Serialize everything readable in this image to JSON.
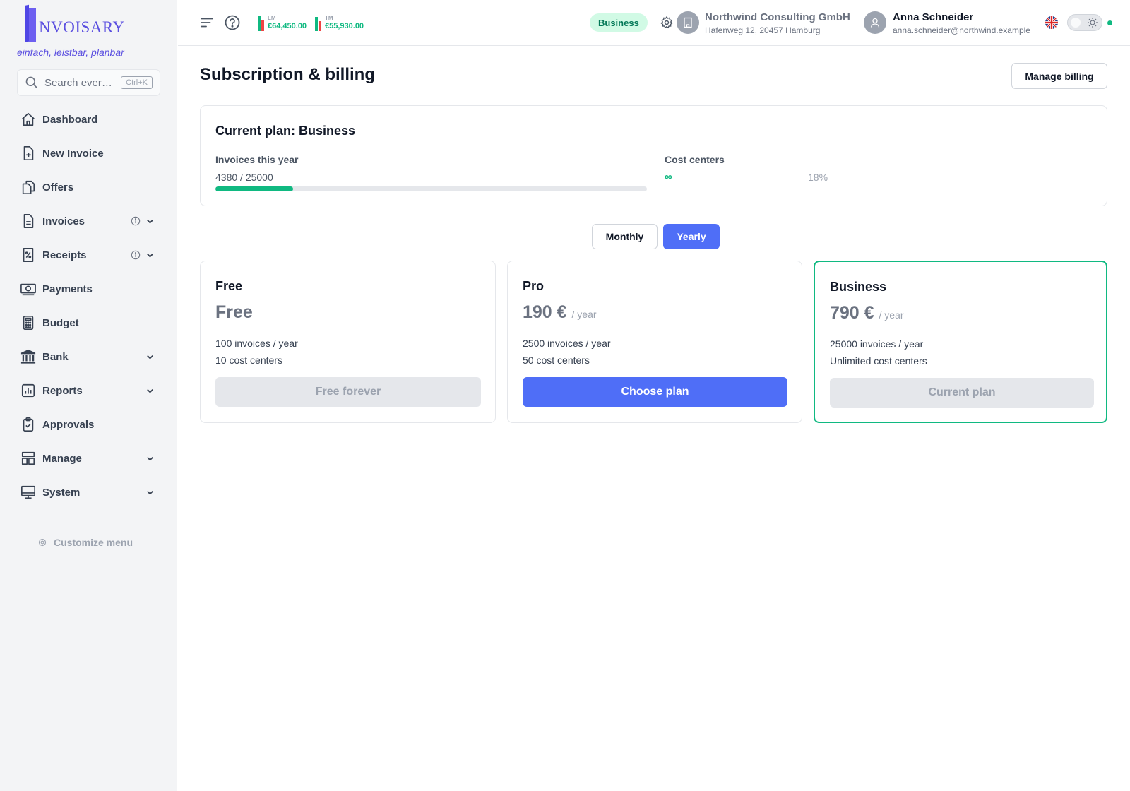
{
  "brand": {
    "logo_text": "NVOISARY",
    "tagline": "einfach, leistbar, planbar",
    "accent": "#5b4fe0"
  },
  "search": {
    "placeholder": "Search ever…",
    "shortcut": "Ctrl+K"
  },
  "sidebar": {
    "items": [
      {
        "label": "Dashboard",
        "icon": "home-icon",
        "info": false,
        "chevron": false
      },
      {
        "label": "New Invoice",
        "icon": "file-plus-icon",
        "info": false,
        "chevron": false
      },
      {
        "label": "Offers",
        "icon": "copy-icon",
        "info": false,
        "chevron": false
      },
      {
        "label": "Invoices",
        "icon": "file-text-icon",
        "info": true,
        "chevron": true
      },
      {
        "label": "Receipts",
        "icon": "receipt-percent-icon",
        "info": true,
        "chevron": true
      },
      {
        "label": "Payments",
        "icon": "banknote-icon",
        "info": false,
        "chevron": false
      },
      {
        "label": "Budget",
        "icon": "calculator-icon",
        "info": false,
        "chevron": false
      },
      {
        "label": "Bank",
        "icon": "bank-icon",
        "info": false,
        "chevron": true
      },
      {
        "label": "Reports",
        "icon": "chart-icon",
        "info": false,
        "chevron": true
      },
      {
        "label": "Approvals",
        "icon": "clipboard-check-icon",
        "info": false,
        "chevron": false
      },
      {
        "label": "Manage",
        "icon": "layout-icon",
        "info": false,
        "chevron": true
      },
      {
        "label": "System",
        "icon": "monitor-icon",
        "info": false,
        "chevron": true
      }
    ],
    "customize_label": "Customize menu"
  },
  "header": {
    "stats": [
      {
        "label": "LM",
        "value": "€64,450.00"
      },
      {
        "label": "TM",
        "value": "€55,930.00"
      }
    ],
    "plan_badge": "Business",
    "company": {
      "name": "Northwind Consulting GmbH",
      "address": "Hafenweg 12, 20457 Hamburg"
    },
    "user": {
      "name": "Anna Schneider",
      "email": "anna.schneider@northwind.example"
    }
  },
  "page": {
    "title": "Subscription & billing",
    "manage_billing_label": "Manage billing"
  },
  "current_plan": {
    "title": "Current plan: Business",
    "invoices_label": "Invoices this year",
    "invoices_count": "4380 / 25000",
    "invoices_percent_label": "18%",
    "invoices_fraction": 0.18,
    "cost_centers_label": "Cost centers",
    "cost_centers_value": "∞"
  },
  "period_toggle": {
    "monthly_label": "Monthly",
    "yearly_label": "Yearly",
    "selected": "Yearly"
  },
  "plans": [
    {
      "name": "Free",
      "price": "Free",
      "period": "",
      "feature_1": "100 invoices / year",
      "feature_2": "10 cost centers",
      "button_label": "Free forever"
    },
    {
      "name": "Pro",
      "price": "190 €",
      "period": "/ year",
      "feature_1": "2500 invoices / year",
      "feature_2": "50 cost centers",
      "button_label": "Choose plan"
    },
    {
      "name": "Business",
      "price": "790 €",
      "period": "/ year",
      "feature_1": "25000 invoices / year",
      "feature_2": "Unlimited cost centers",
      "button_label": "Current plan"
    }
  ],
  "colors": {
    "primary": "#4f6ef7",
    "success": "#10b981",
    "badge_bg": "#d1fae5"
  }
}
